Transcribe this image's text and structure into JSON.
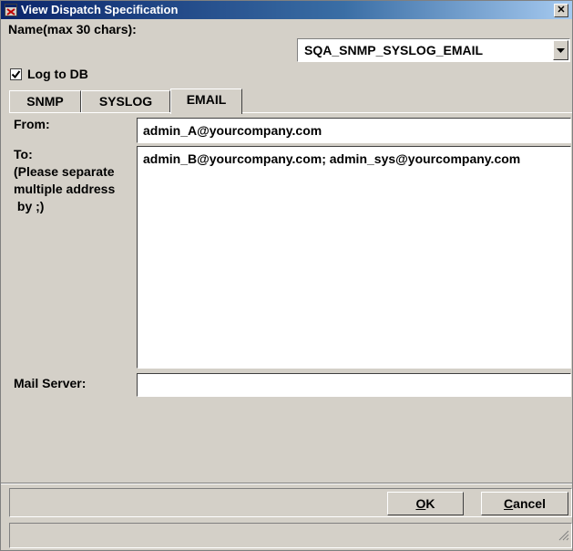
{
  "window": {
    "title": "View Dispatch Specification",
    "close_symbol": "✕",
    "icon": "app-window-icon"
  },
  "name_field": {
    "label": "Name(max 30 chars):",
    "selected": "SQA_SNMP_SYSLOG_EMAIL"
  },
  "log_to_db": {
    "label": "Log to DB",
    "checked": true
  },
  "tabs": [
    {
      "label": "SNMP",
      "active": false
    },
    {
      "label": "SYSLOG",
      "active": false
    },
    {
      "label": "EMAIL",
      "active": true
    }
  ],
  "email": {
    "from_label": "From:",
    "from_value": "admin_A@yourcompany.com",
    "to_label_lines": [
      "To:",
      "(Please separate",
      "multiple address",
      " by ;)"
    ],
    "to_value": "admin_B@yourcompany.com; admin_sys@yourcompany.com",
    "mail_server_label": "Mail Server:",
    "mail_server_value": ""
  },
  "buttons": {
    "ok": {
      "label": "OK",
      "mnemonic": "O"
    },
    "cancel": {
      "label": "Cancel",
      "mnemonic": "C"
    }
  },
  "icons": [
    "app-window-icon",
    "close-icon",
    "dropdown-arrow-icon",
    "checkmark-icon",
    "resize-grip-icon"
  ]
}
